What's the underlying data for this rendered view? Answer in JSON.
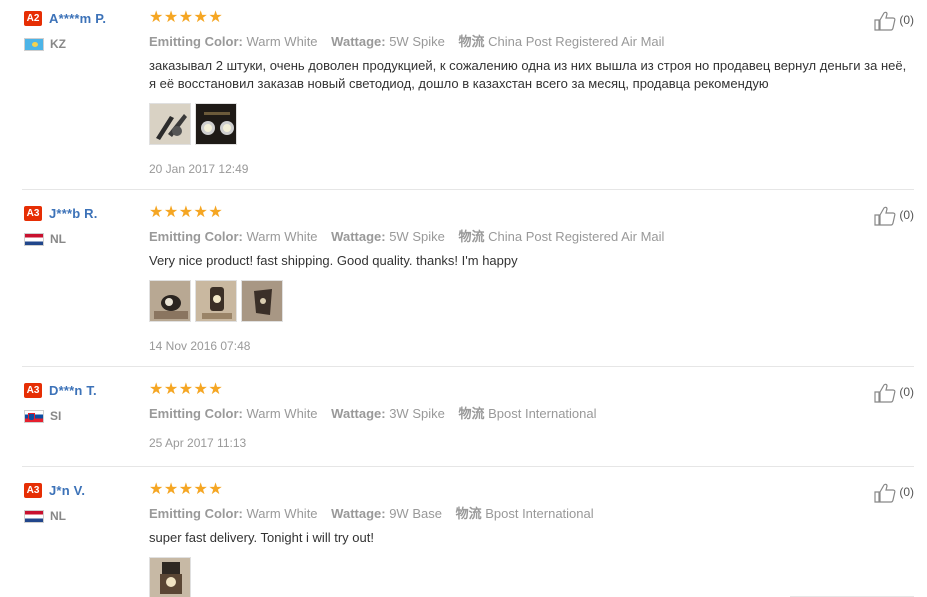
{
  "reviews": [
    {
      "level": "A2",
      "name": "A****m P.",
      "country": "KZ",
      "rating": "★★★★★",
      "attrs": [
        {
          "label": "Emitting Color:",
          "value": "Warm White"
        },
        {
          "label": "Wattage:",
          "value": "5W Spike"
        },
        {
          "label": "物流",
          "value": "China Post Registered Air Mail"
        }
      ],
      "text": "заказывал 2 штуки, очень доволен продукцией, к сожалению одна из них вышла из строя но продавец вернул деньги за неё, я её восстановил заказав новый светодиод, дошло в казахстан всего за месяц, продавца рекомендую",
      "date": "20 Jan 2017 12:49",
      "helpful": "(0)"
    },
    {
      "level": "A3",
      "name": "J***b R.",
      "country": "NL",
      "rating": "★★★★★",
      "attrs": [
        {
          "label": "Emitting Color:",
          "value": "Warm White"
        },
        {
          "label": "Wattage:",
          "value": "5W Spike"
        },
        {
          "label": "物流",
          "value": "China Post Registered Air Mail"
        }
      ],
      "text": "Very nice product! fast shipping. Good quality. thanks! I'm happy",
      "date": "14 Nov 2016 07:48",
      "helpful": "(0)"
    },
    {
      "level": "A3",
      "name": "D***n T.",
      "country": "SI",
      "rating": "★★★★★",
      "attrs": [
        {
          "label": "Emitting Color:",
          "value": "Warm White"
        },
        {
          "label": "Wattage:",
          "value": "3W Spike"
        },
        {
          "label": "物流",
          "value": "Bpost International"
        }
      ],
      "text": "",
      "date": "25 Apr 2017 11:13",
      "helpful": "(0)"
    },
    {
      "level": "A3",
      "name": "J*n V.",
      "country": "NL",
      "rating": "★★★★★",
      "attrs": [
        {
          "label": "Emitting Color:",
          "value": "Warm White"
        },
        {
          "label": "Wattage:",
          "value": "9W Base"
        },
        {
          "label": "物流",
          "value": "Bpost International"
        }
      ],
      "text": "super fast delivery. Tonight i will try out!",
      "date": "",
      "helpful": "(0)"
    }
  ],
  "colors": {
    "level_badge": "#e62e04",
    "username": "#3c72b8",
    "stars": "#f5a623"
  },
  "icons": {
    "helpful": "thumbs-up-icon"
  }
}
